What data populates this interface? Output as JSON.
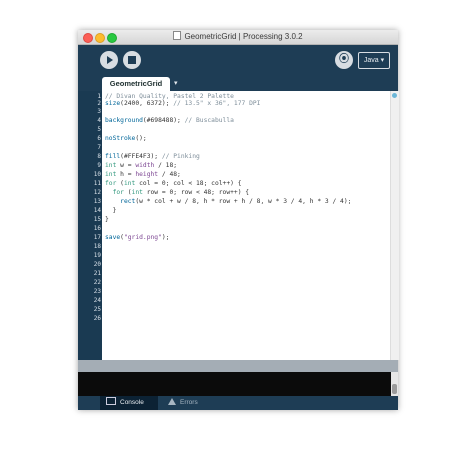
{
  "window": {
    "title": "GeometricGrid | Processing 3.0.2"
  },
  "toolbar": {
    "mode_label": "Java ▾",
    "debug_glyph": "⦿"
  },
  "tabs": {
    "sketch_name": "GeometricGrid",
    "menu_glyph": "▾"
  },
  "editor": {
    "line_numbers": [
      "1",
      "2",
      "3",
      "4",
      "5",
      "6",
      "7",
      "8",
      "9",
      "10",
      "11",
      "12",
      "13",
      "14",
      "15",
      "16",
      "17",
      "18",
      "19",
      "20",
      "21",
      "22",
      "23",
      "24",
      "25",
      "26"
    ],
    "code": [
      "// Divan Quality, Pastel 2 Palette",
      "size(2400, 6372); // 13.5\" x 36\", 177 DPI",
      "",
      "background(#698488); // Buscabulla",
      "",
      "noStroke();",
      "",
      "fill(#FFE4F3); // Pinking",
      "int w = width / 18;",
      "int h = height / 48;",
      "for (int col = 0; col < 18; col++) {",
      "  for (int row = 0; row < 48; row++) {",
      "    rect(w * col + w / 8, h * row + h / 8, w * 3 / 4, h * 3 / 4);",
      "  }",
      "}",
      "",
      "save(\"grid.png\");"
    ]
  },
  "footer": {
    "console_label": "Console",
    "errors_label": "Errors"
  }
}
